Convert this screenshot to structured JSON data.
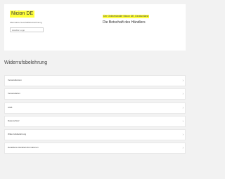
{
  "header": {
    "shop_name": "Nicion DE",
    "shop_subtitle": "Alternative Geschäftsbezeichnung",
    "logo_alt": "Händler-Logo",
    "seller_note": "Der Onlinehändler Nicion DE, Deutschland",
    "seller_message": "Die Botschaft des Händlers"
  },
  "section": {
    "title": "Widerrufsbelehrung"
  },
  "accordion": [
    {
      "label": "Versandkosten"
    },
    {
      "label": "Versandarten"
    },
    {
      "label": "AGB"
    },
    {
      "label": "Datenschutz"
    },
    {
      "label": "Widerrufsbelehrung"
    },
    {
      "label": "Detaillierte Händlerinformationen"
    }
  ],
  "icons": {
    "chevron": "chevron-right-icon"
  },
  "colors": {
    "highlight": "#ffff3b",
    "background": "#f2f2f2",
    "card": "#ffffff"
  }
}
